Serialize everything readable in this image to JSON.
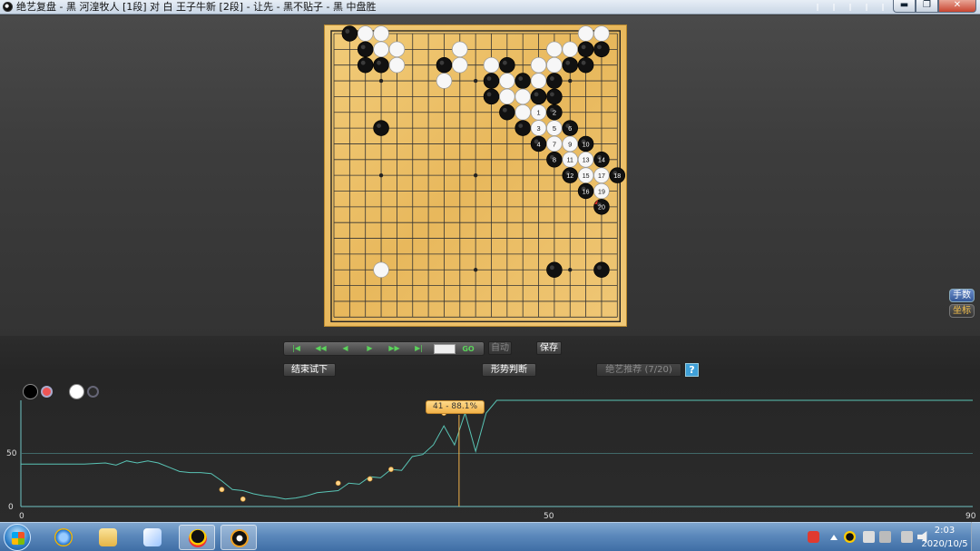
{
  "window": {
    "title": "绝艺复盘 - 黑 河湟牧人 [1段] 对 白 王子牛新 [2段] - 让先 - 黑不贴子 - 黑 中盘胜",
    "buttons": {
      "minimize": "▬",
      "maximize": "❐",
      "close": "✕"
    }
  },
  "board": {
    "size": 19,
    "star_points": [
      [
        3,
        3
      ],
      [
        3,
        9
      ],
      [
        3,
        15
      ],
      [
        9,
        3
      ],
      [
        9,
        9
      ],
      [
        9,
        15
      ],
      [
        15,
        3
      ],
      [
        15,
        9
      ],
      [
        15,
        15
      ]
    ],
    "stones": [
      {
        "c": "b",
        "x": 1,
        "y": 0
      },
      {
        "c": "w",
        "x": 2,
        "y": 0
      },
      {
        "c": "w",
        "x": 3,
        "y": 0
      },
      {
        "c": "b",
        "x": 2,
        "y": 1
      },
      {
        "c": "w",
        "x": 3,
        "y": 1
      },
      {
        "c": "w",
        "x": 4,
        "y": 1
      },
      {
        "c": "b",
        "x": 2,
        "y": 2
      },
      {
        "c": "b",
        "x": 3,
        "y": 2
      },
      {
        "c": "w",
        "x": 4,
        "y": 2
      },
      {
        "c": "w",
        "x": 8,
        "y": 1
      },
      {
        "c": "b",
        "x": 7,
        "y": 2
      },
      {
        "c": "w",
        "x": 8,
        "y": 2
      },
      {
        "c": "w",
        "x": 7,
        "y": 3
      },
      {
        "c": "w",
        "x": 16,
        "y": 0
      },
      {
        "c": "w",
        "x": 17,
        "y": 0
      },
      {
        "c": "w",
        "x": 14,
        "y": 1
      },
      {
        "c": "w",
        "x": 15,
        "y": 1
      },
      {
        "c": "b",
        "x": 16,
        "y": 1
      },
      {
        "c": "b",
        "x": 17,
        "y": 1
      },
      {
        "c": "b",
        "x": 15,
        "y": 2
      },
      {
        "c": "b",
        "x": 16,
        "y": 2
      },
      {
        "c": "w",
        "x": 14,
        "y": 2
      },
      {
        "c": "w",
        "x": 10,
        "y": 2
      },
      {
        "c": "b",
        "x": 11,
        "y": 2
      },
      {
        "c": "w",
        "x": 13,
        "y": 2
      },
      {
        "c": "b",
        "x": 10,
        "y": 3
      },
      {
        "c": "w",
        "x": 11,
        "y": 3
      },
      {
        "c": "b",
        "x": 12,
        "y": 3
      },
      {
        "c": "w",
        "x": 13,
        "y": 3
      },
      {
        "c": "b",
        "x": 14,
        "y": 3
      },
      {
        "c": "b",
        "x": 10,
        "y": 4
      },
      {
        "c": "w",
        "x": 11,
        "y": 4
      },
      {
        "c": "w",
        "x": 12,
        "y": 4
      },
      {
        "c": "b",
        "x": 13,
        "y": 4
      },
      {
        "c": "b",
        "x": 14,
        "y": 4
      },
      {
        "c": "b",
        "x": 11,
        "y": 5
      },
      {
        "c": "w",
        "x": 12,
        "y": 5
      },
      {
        "c": "b",
        "x": 12,
        "y": 6
      },
      {
        "c": "b",
        "x": 3,
        "y": 6
      },
      {
        "c": "w",
        "x": 3,
        "y": 15
      },
      {
        "c": "b",
        "x": 14,
        "y": 15
      },
      {
        "c": "b",
        "x": 17,
        "y": 15
      }
    ],
    "numbered": [
      {
        "c": "w",
        "x": 13,
        "y": 5,
        "n": "1"
      },
      {
        "c": "b",
        "x": 14,
        "y": 5,
        "n": "2"
      },
      {
        "c": "w",
        "x": 13,
        "y": 6,
        "n": "3"
      },
      {
        "c": "b",
        "x": 13,
        "y": 7,
        "n": "4"
      },
      {
        "c": "w",
        "x": 14,
        "y": 6,
        "n": "5"
      },
      {
        "c": "b",
        "x": 15,
        "y": 6,
        "n": "6"
      },
      {
        "c": "w",
        "x": 14,
        "y": 7,
        "n": "7"
      },
      {
        "c": "b",
        "x": 14,
        "y": 8,
        "n": "8"
      },
      {
        "c": "w",
        "x": 15,
        "y": 7,
        "n": "9"
      },
      {
        "c": "b",
        "x": 16,
        "y": 7,
        "n": "10"
      },
      {
        "c": "w",
        "x": 15,
        "y": 8,
        "n": "11"
      },
      {
        "c": "b",
        "x": 15,
        "y": 9,
        "n": "12"
      },
      {
        "c": "w",
        "x": 16,
        "y": 8,
        "n": "13"
      },
      {
        "c": "b",
        "x": 17,
        "y": 8,
        "n": "14"
      },
      {
        "c": "w",
        "x": 16,
        "y": 9,
        "n": "15"
      },
      {
        "c": "b",
        "x": 16,
        "y": 10,
        "n": "16"
      },
      {
        "c": "w",
        "x": 17,
        "y": 9,
        "n": "17"
      },
      {
        "c": "b",
        "x": 18,
        "y": 9,
        "n": "18"
      },
      {
        "c": "w",
        "x": 17,
        "y": 10,
        "n": "19"
      },
      {
        "c": "b",
        "x": 17,
        "y": 11,
        "n": "20"
      }
    ]
  },
  "side_tabs": {
    "moves": "手数",
    "coords": "坐标"
  },
  "controls": {
    "nav": {
      "first": "|◀",
      "prev10": "◀◀",
      "prev": "◀",
      "next": "▶",
      "next10": "▶▶",
      "last": "▶|",
      "go": "GO"
    },
    "auto": "自动",
    "save": "保存",
    "end_trial": "结束试下",
    "judge": "形势判断",
    "ai_recommend": "绝艺推荐 (7/20)",
    "help": "?"
  },
  "colors": {
    "accent": "#f2b24a",
    "line": "#59c4b5",
    "panel": "#2b2b2b"
  },
  "chart_data": {
    "type": "line",
    "x_ticks": [
      "0",
      "50",
      "90"
    ],
    "y_ticks": [
      "0",
      "50"
    ],
    "xlim": [
      0,
      90
    ],
    "ylim": [
      0,
      100
    ],
    "tooltip": "41 - 88.1%",
    "current_move": 41,
    "series": [
      {
        "values": [
          [
            0,
            40
          ],
          [
            2,
            40
          ],
          [
            4,
            40
          ],
          [
            6,
            40
          ],
          [
            8,
            41
          ],
          [
            9,
            39
          ],
          [
            10,
            43
          ],
          [
            11,
            41
          ],
          [
            12,
            43
          ],
          [
            13,
            41
          ],
          [
            14,
            37
          ],
          [
            15,
            33
          ],
          [
            16,
            32
          ],
          [
            17,
            32
          ],
          [
            18,
            31
          ],
          [
            19,
            24
          ],
          [
            20,
            16
          ],
          [
            21,
            15
          ],
          [
            22,
            12
          ],
          [
            23,
            10
          ],
          [
            24,
            9
          ],
          [
            25,
            7
          ],
          [
            26,
            8
          ],
          [
            27,
            10
          ],
          [
            28,
            13
          ],
          [
            29,
            14
          ],
          [
            30,
            15
          ],
          [
            31,
            22
          ],
          [
            32,
            21
          ],
          [
            33,
            28
          ],
          [
            34,
            27
          ],
          [
            35,
            35
          ],
          [
            36,
            34
          ],
          [
            37,
            47
          ],
          [
            38,
            49
          ],
          [
            39,
            58
          ],
          [
            40,
            76
          ],
          [
            41,
            58
          ],
          [
            42,
            88
          ],
          [
            43,
            52
          ],
          [
            44,
            88
          ],
          [
            45,
            100
          ],
          [
            90,
            100
          ]
        ],
        "markers": [
          [
            19,
            16
          ],
          [
            21,
            7
          ],
          [
            30,
            22
          ],
          [
            33,
            26
          ],
          [
            35,
            35
          ],
          [
            40,
            88
          ]
        ]
      }
    ]
  },
  "taskbar": {
    "time": "2:03",
    "date": "2020/10/5"
  }
}
